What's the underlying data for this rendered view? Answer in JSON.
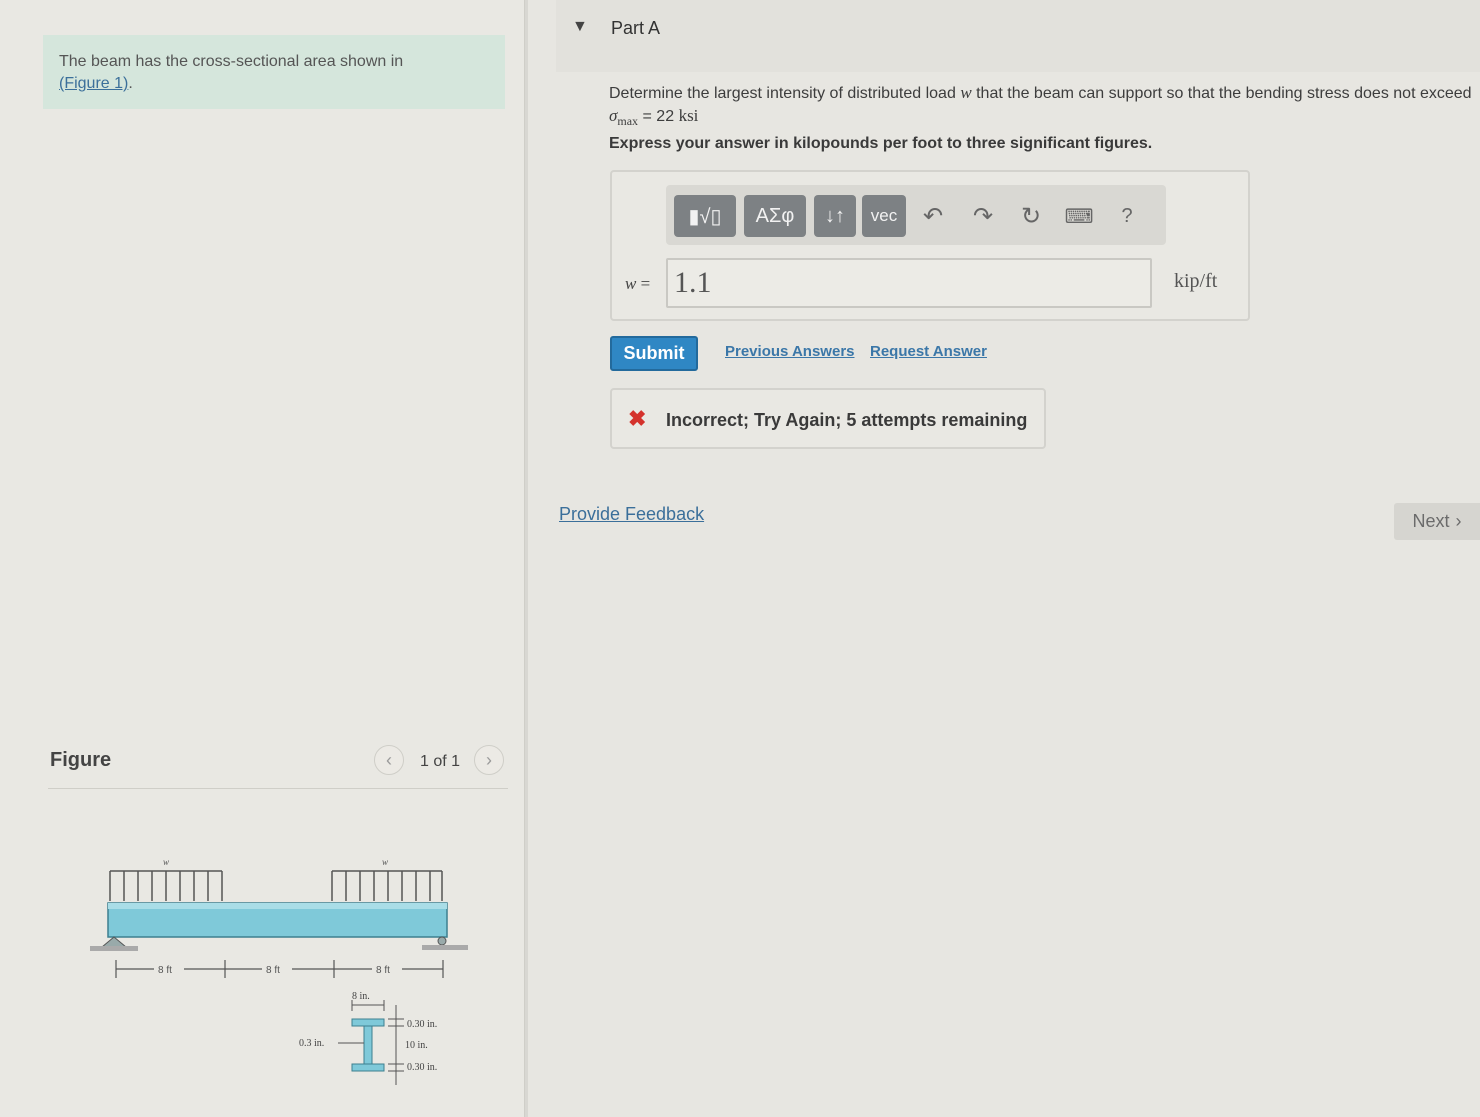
{
  "intro": {
    "text": "The beam has the cross-sectional area shown in",
    "figure_link": "(Figure 1)",
    "suffix": "."
  },
  "figure": {
    "title": "Figure",
    "count": "1 of 1",
    "load_label": "w",
    "span_labels": [
      "8 ft",
      "8 ft",
      "8 ft"
    ],
    "dims": {
      "flange_width": "8 in.",
      "web_thickness": "0.3 in.",
      "top_flange": "0.30 in.",
      "web_height": "10 in.",
      "bottom_flange": "0.30 in."
    }
  },
  "part": {
    "title": "Part A"
  },
  "question": {
    "line1": "Determine the largest intensity of distributed load",
    "var": "w",
    "line1b": "that the beam can support so that the bending stress does not exceed",
    "sigma": "σ",
    "sub": "max",
    "eq": "= 22",
    "unit": "ksi",
    "instruction": "Express your answer in kilopounds per foot to three significant figures."
  },
  "toolbar": {
    "templates_label": "▮√▯",
    "greek_label": "ΑΣφ",
    "arrows_label": "↓↑",
    "vec_label": "vec",
    "undo_icon": "undo-icon",
    "redo_icon": "redo-icon",
    "reset_icon": "reset-icon",
    "keyboard_icon": "keyboard-icon",
    "help_label": "?"
  },
  "answer": {
    "var_label": "w",
    "equals": "=",
    "value": "1.1",
    "unit": "kip/ft"
  },
  "actions": {
    "submit": "Submit",
    "previous": "Previous Answers",
    "request": "Request Answer"
  },
  "feedback": {
    "text": "Incorrect; Try Again; 5 attempts remaining",
    "status_color": "#d4322c"
  },
  "footer": {
    "provide_feedback": "Provide Feedback",
    "next": "Next"
  },
  "colors": {
    "submit_bg": "#2f87c4",
    "intro_bg": "#d5e6dc",
    "beam": "#7fc9d9"
  }
}
